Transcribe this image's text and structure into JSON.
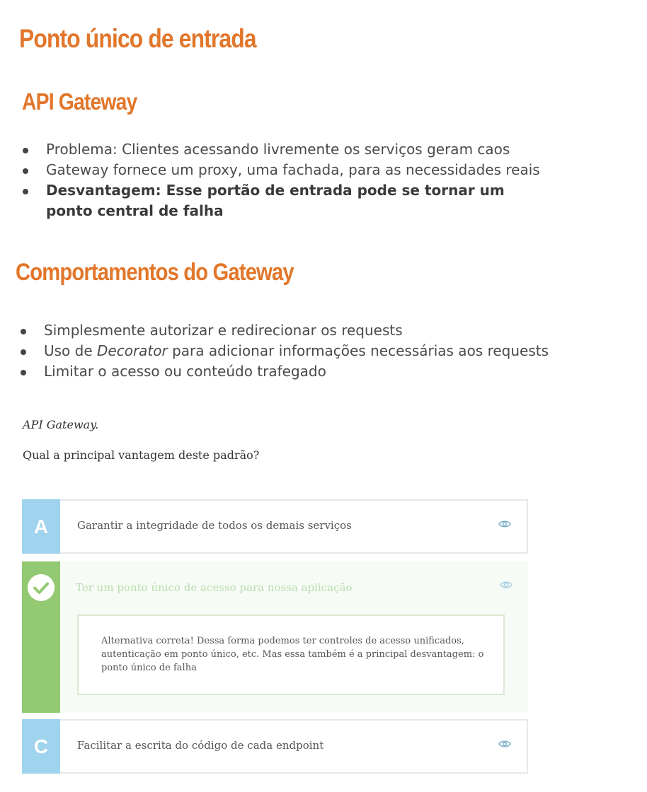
{
  "slides": {
    "title_1": "Ponto único de entrada",
    "title_2": "API Gateway",
    "bullets_1": [
      "Problema: Clientes acessando livremente os serviços geram caos",
      "Gateway fornece um proxy, uma fachada, para as necessidades reais",
      "Desvantagem: Esse portão de entrada pode se tornar um ponto central de falha"
    ],
    "title_3": "Comportamentos do Gateway",
    "bullets_2": [
      "Simplesmente autorizar e redirecionar os requests",
      {
        "before": "Uso de ",
        "emphasis": "Decorator",
        "after": " para adicionar informações necessárias aos requests"
      },
      "Limitar o acesso ou conteúdo trafegado"
    ]
  },
  "question": {
    "intro": "API Gateway.",
    "text": "Qual a principal vantagem deste padrão?"
  },
  "options": [
    {
      "letter": "A",
      "text": "Garantir a integridade de todos os demais serviços",
      "icon": "eye-icon"
    },
    {
      "letter": "",
      "text": "Ter um ponto único de acesso para nossa aplicação",
      "icon": "eye-icon",
      "status_icon": "check-icon",
      "feedback": "Alternativa correta! Dessa forma podemos ter controles de acesso unificados, autenticação em ponto único, etc. Mas essa também é a principal desvantagem: o ponto único de falha"
    },
    {
      "letter": "C",
      "text": "Facilitar a escrita do código de cada endpoint",
      "icon": "eye-icon"
    }
  ],
  "colors": {
    "title_orange": "#e2762a",
    "letter_blue": "#9fd3ee",
    "correct_green": "#94c973",
    "eye_blue": "#7fb0c8"
  }
}
